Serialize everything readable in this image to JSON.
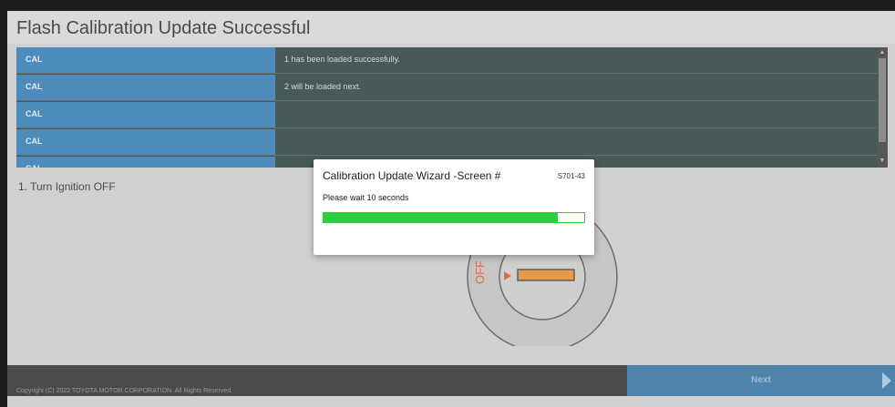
{
  "title": "Flash Calibration Update Successful",
  "cal_rows": [
    {
      "key": "CAL",
      "value": "1 has been loaded successfully."
    },
    {
      "key": "CAL",
      "value": "2 will be loaded next."
    },
    {
      "key": "CAL",
      "value": ""
    },
    {
      "key": "CAL",
      "value": ""
    },
    {
      "key": "CAL",
      "value": ""
    }
  ],
  "instruction": "1. Turn Ignition OFF",
  "ignition_label": "OFF",
  "footer": {
    "next_label": "Next",
    "copyright": "Copyright (C) 2022 TOYOTA MOTOR CORPORATION. All Rights Reserved."
  },
  "dialog": {
    "title": "Calibration Update Wizard -Screen #",
    "code": "S701-43",
    "message": "Please wait 10 seconds",
    "progress": 0.9
  },
  "colors": {
    "accent_blue": "#2e77ae",
    "progress_green": "#2ecc40",
    "ignition_orange": "#e0892a"
  }
}
